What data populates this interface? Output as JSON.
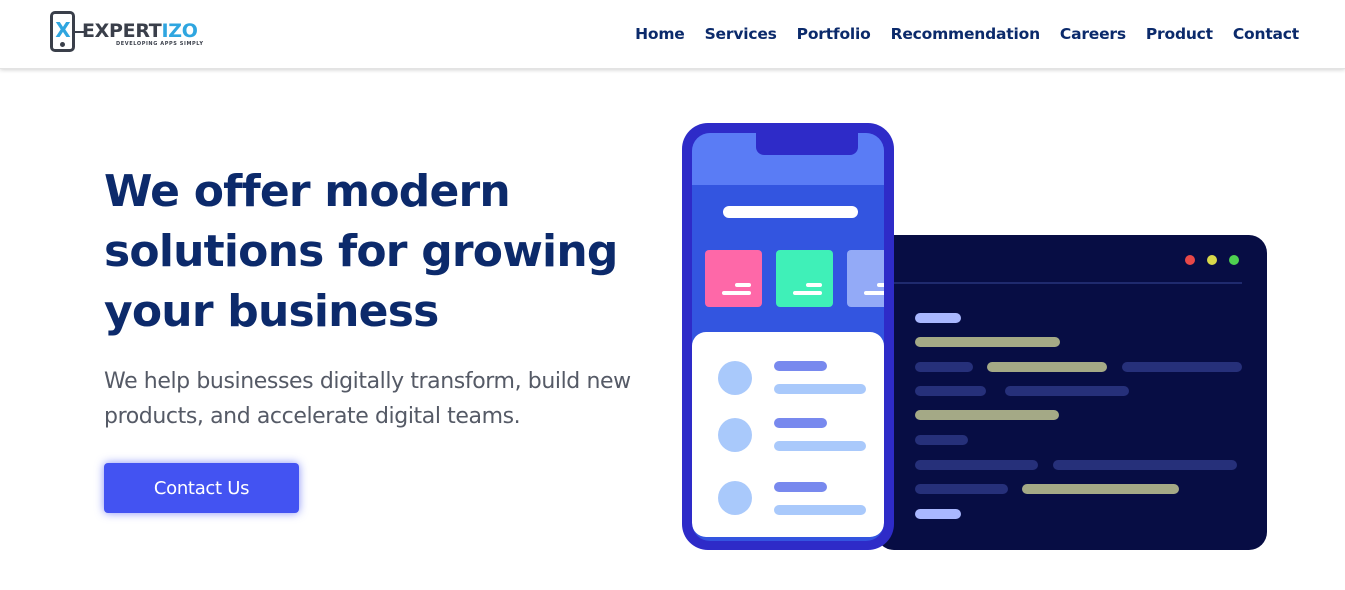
{
  "brand": {
    "logo_mark": "X",
    "name_part1": "EXPERT",
    "name_part2": "IZO",
    "tagline": "DEVELOPING APPS SIMPLY"
  },
  "nav": {
    "items": [
      "Home",
      "Services",
      "Portfolio",
      "Recommendation",
      "Careers",
      "Product",
      "Contact"
    ]
  },
  "hero": {
    "title": "We offer modern solutions for growing your business",
    "subtitle": "We help businesses digitally transform, build new products, and accelerate digital teams.",
    "cta_label": "Contact Us"
  },
  "colors": {
    "nav_text": "#0b2a6b",
    "title": "#0c2a6b",
    "subtitle": "#555a66",
    "cta": "#4353f2",
    "logo_blue": "#2fa6e0",
    "logo_dark": "#3a3f4a",
    "code_window": "#070d44",
    "phone_frame": "#2e2bc8"
  },
  "illustration": {
    "icon": "app-development-illustration"
  }
}
